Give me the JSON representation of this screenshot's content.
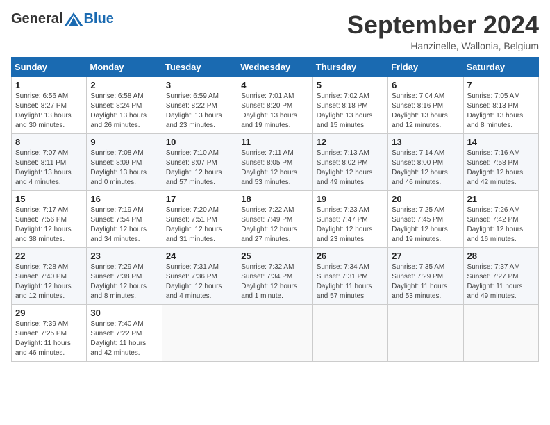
{
  "header": {
    "logo_general": "General",
    "logo_blue": "Blue",
    "month_title": "September 2024",
    "subtitle": "Hanzinelle, Wallonia, Belgium"
  },
  "days_of_week": [
    "Sunday",
    "Monday",
    "Tuesday",
    "Wednesday",
    "Thursday",
    "Friday",
    "Saturday"
  ],
  "weeks": [
    [
      {
        "day": "1",
        "sunrise": "Sunrise: 6:56 AM",
        "sunset": "Sunset: 8:27 PM",
        "daylight": "Daylight: 13 hours and 30 minutes."
      },
      {
        "day": "2",
        "sunrise": "Sunrise: 6:58 AM",
        "sunset": "Sunset: 8:24 PM",
        "daylight": "Daylight: 13 hours and 26 minutes."
      },
      {
        "day": "3",
        "sunrise": "Sunrise: 6:59 AM",
        "sunset": "Sunset: 8:22 PM",
        "daylight": "Daylight: 13 hours and 23 minutes."
      },
      {
        "day": "4",
        "sunrise": "Sunrise: 7:01 AM",
        "sunset": "Sunset: 8:20 PM",
        "daylight": "Daylight: 13 hours and 19 minutes."
      },
      {
        "day": "5",
        "sunrise": "Sunrise: 7:02 AM",
        "sunset": "Sunset: 8:18 PM",
        "daylight": "Daylight: 13 hours and 15 minutes."
      },
      {
        "day": "6",
        "sunrise": "Sunrise: 7:04 AM",
        "sunset": "Sunset: 8:16 PM",
        "daylight": "Daylight: 13 hours and 12 minutes."
      },
      {
        "day": "7",
        "sunrise": "Sunrise: 7:05 AM",
        "sunset": "Sunset: 8:13 PM",
        "daylight": "Daylight: 13 hours and 8 minutes."
      }
    ],
    [
      {
        "day": "8",
        "sunrise": "Sunrise: 7:07 AM",
        "sunset": "Sunset: 8:11 PM",
        "daylight": "Daylight: 13 hours and 4 minutes."
      },
      {
        "day": "9",
        "sunrise": "Sunrise: 7:08 AM",
        "sunset": "Sunset: 8:09 PM",
        "daylight": "Daylight: 13 hours and 0 minutes."
      },
      {
        "day": "10",
        "sunrise": "Sunrise: 7:10 AM",
        "sunset": "Sunset: 8:07 PM",
        "daylight": "Daylight: 12 hours and 57 minutes."
      },
      {
        "day": "11",
        "sunrise": "Sunrise: 7:11 AM",
        "sunset": "Sunset: 8:05 PM",
        "daylight": "Daylight: 12 hours and 53 minutes."
      },
      {
        "day": "12",
        "sunrise": "Sunrise: 7:13 AM",
        "sunset": "Sunset: 8:02 PM",
        "daylight": "Daylight: 12 hours and 49 minutes."
      },
      {
        "day": "13",
        "sunrise": "Sunrise: 7:14 AM",
        "sunset": "Sunset: 8:00 PM",
        "daylight": "Daylight: 12 hours and 46 minutes."
      },
      {
        "day": "14",
        "sunrise": "Sunrise: 7:16 AM",
        "sunset": "Sunset: 7:58 PM",
        "daylight": "Daylight: 12 hours and 42 minutes."
      }
    ],
    [
      {
        "day": "15",
        "sunrise": "Sunrise: 7:17 AM",
        "sunset": "Sunset: 7:56 PM",
        "daylight": "Daylight: 12 hours and 38 minutes."
      },
      {
        "day": "16",
        "sunrise": "Sunrise: 7:19 AM",
        "sunset": "Sunset: 7:54 PM",
        "daylight": "Daylight: 12 hours and 34 minutes."
      },
      {
        "day": "17",
        "sunrise": "Sunrise: 7:20 AM",
        "sunset": "Sunset: 7:51 PM",
        "daylight": "Daylight: 12 hours and 31 minutes."
      },
      {
        "day": "18",
        "sunrise": "Sunrise: 7:22 AM",
        "sunset": "Sunset: 7:49 PM",
        "daylight": "Daylight: 12 hours and 27 minutes."
      },
      {
        "day": "19",
        "sunrise": "Sunrise: 7:23 AM",
        "sunset": "Sunset: 7:47 PM",
        "daylight": "Daylight: 12 hours and 23 minutes."
      },
      {
        "day": "20",
        "sunrise": "Sunrise: 7:25 AM",
        "sunset": "Sunset: 7:45 PM",
        "daylight": "Daylight: 12 hours and 19 minutes."
      },
      {
        "day": "21",
        "sunrise": "Sunrise: 7:26 AM",
        "sunset": "Sunset: 7:42 PM",
        "daylight": "Daylight: 12 hours and 16 minutes."
      }
    ],
    [
      {
        "day": "22",
        "sunrise": "Sunrise: 7:28 AM",
        "sunset": "Sunset: 7:40 PM",
        "daylight": "Daylight: 12 hours and 12 minutes."
      },
      {
        "day": "23",
        "sunrise": "Sunrise: 7:29 AM",
        "sunset": "Sunset: 7:38 PM",
        "daylight": "Daylight: 12 hours and 8 minutes."
      },
      {
        "day": "24",
        "sunrise": "Sunrise: 7:31 AM",
        "sunset": "Sunset: 7:36 PM",
        "daylight": "Daylight: 12 hours and 4 minutes."
      },
      {
        "day": "25",
        "sunrise": "Sunrise: 7:32 AM",
        "sunset": "Sunset: 7:34 PM",
        "daylight": "Daylight: 12 hours and 1 minute."
      },
      {
        "day": "26",
        "sunrise": "Sunrise: 7:34 AM",
        "sunset": "Sunset: 7:31 PM",
        "daylight": "Daylight: 11 hours and 57 minutes."
      },
      {
        "day": "27",
        "sunrise": "Sunrise: 7:35 AM",
        "sunset": "Sunset: 7:29 PM",
        "daylight": "Daylight: 11 hours and 53 minutes."
      },
      {
        "day": "28",
        "sunrise": "Sunrise: 7:37 AM",
        "sunset": "Sunset: 7:27 PM",
        "daylight": "Daylight: 11 hours and 49 minutes."
      }
    ],
    [
      {
        "day": "29",
        "sunrise": "Sunrise: 7:39 AM",
        "sunset": "Sunset: 7:25 PM",
        "daylight": "Daylight: 11 hours and 46 minutes."
      },
      {
        "day": "30",
        "sunrise": "Sunrise: 7:40 AM",
        "sunset": "Sunset: 7:22 PM",
        "daylight": "Daylight: 11 hours and 42 minutes."
      },
      null,
      null,
      null,
      null,
      null
    ]
  ]
}
